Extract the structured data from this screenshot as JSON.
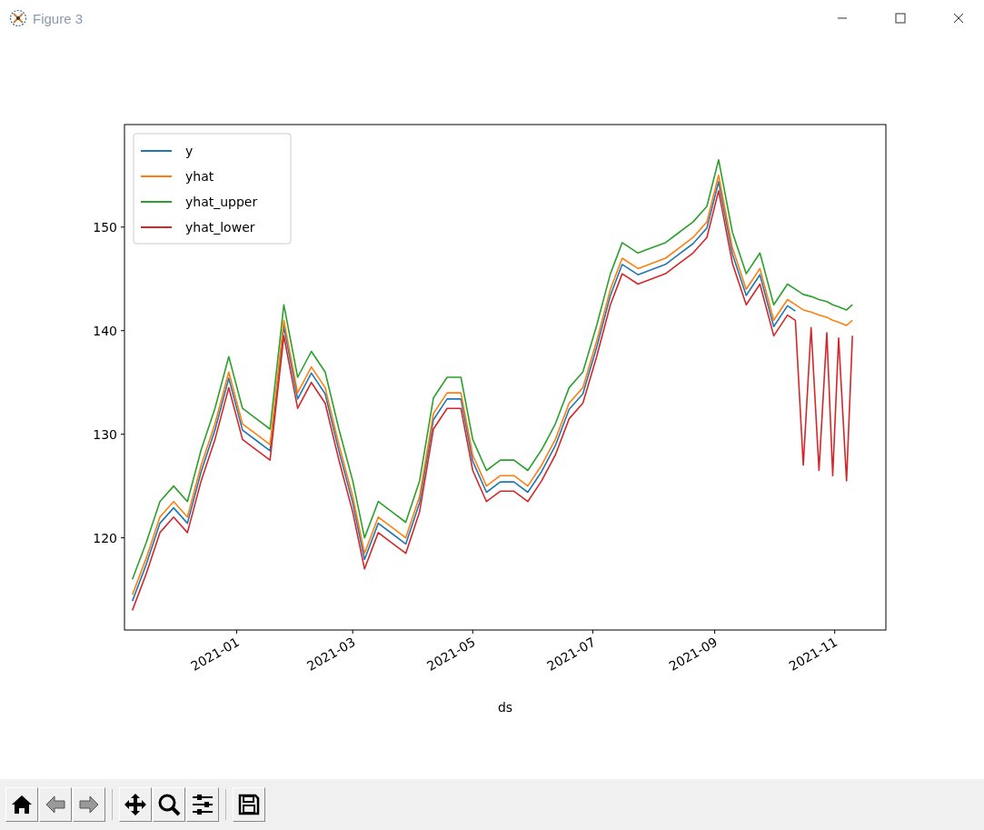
{
  "window": {
    "title": "Figure 3"
  },
  "figure": {
    "chart_data": {
      "type": "line",
      "xlabel": "ds",
      "x": [
        "2020-11-09",
        "2020-11-16",
        "2020-11-23",
        "2020-11-30",
        "2020-12-07",
        "2020-12-14",
        "2020-12-21",
        "2020-12-28",
        "2021-01-04",
        "2021-01-11",
        "2021-01-18",
        "2021-01-25",
        "2021-02-01",
        "2021-02-08",
        "2021-02-15",
        "2021-02-22",
        "2021-03-01",
        "2021-03-07",
        "2021-03-14",
        "2021-03-21",
        "2021-03-28",
        "2021-04-04",
        "2021-04-11",
        "2021-04-18",
        "2021-04-25",
        "2021-05-01",
        "2021-05-08",
        "2021-05-15",
        "2021-05-22",
        "2021-05-29",
        "2021-06-05",
        "2021-06-12",
        "2021-06-19",
        "2021-06-26",
        "2021-07-03",
        "2021-07-10",
        "2021-07-16",
        "2021-07-24",
        "2021-07-31",
        "2021-08-07",
        "2021-08-14",
        "2021-08-21",
        "2021-08-28",
        "2021-09-03",
        "2021-09-10",
        "2021-09-17",
        "2021-09-24",
        "2021-10-01",
        "2021-10-08",
        "2021-10-12",
        "2021-10-16",
        "2021-10-20",
        "2021-10-24",
        "2021-10-28",
        "2021-10-31",
        "2021-11-03",
        "2021-11-07",
        "2021-11-10"
      ],
      "series": [
        {
          "name": "y",
          "color": "#1f77b4",
          "values": [
            113.9,
            117.4,
            121.4,
            122.9,
            121.4,
            126.4,
            130.4,
            135.4,
            130.4,
            129.4,
            128.4,
            140.4,
            133.4,
            135.9,
            133.9,
            128.4,
            123.4,
            117.9,
            121.4,
            120.4,
            119.4,
            123.4,
            131.4,
            133.4,
            133.4,
            127.4,
            124.4,
            125.4,
            125.4,
            124.4,
            126.4,
            128.9,
            132.4,
            133.9,
            138.4,
            143.4,
            146.4,
            145.4,
            145.9,
            146.4,
            147.4,
            148.4,
            149.9,
            154.4,
            147.4,
            143.4,
            145.4,
            140.4,
            142.4,
            141.9,
            null,
            null,
            null,
            null,
            null,
            null,
            null,
            null
          ]
        },
        {
          "name": "yhat",
          "color": "#ff7f0e",
          "values": [
            114.5,
            118,
            122,
            123.5,
            122,
            127,
            131,
            136,
            131,
            130,
            129,
            141,
            134,
            136.5,
            134.5,
            129,
            124,
            118.5,
            122,
            121,
            120,
            124,
            132,
            134,
            134,
            128,
            125,
            126,
            126,
            125,
            127,
            129.5,
            133,
            134.5,
            139,
            144,
            147,
            146,
            146.5,
            147,
            148,
            149,
            150.5,
            155,
            148,
            144,
            146,
            141,
            143,
            142.5,
            142,
            141.8,
            141.5,
            141.3,
            141,
            140.8,
            140.5,
            141
          ]
        },
        {
          "name": "yhat_upper",
          "color": "#2ca02c",
          "values": [
            116,
            119.5,
            123.5,
            125,
            123.5,
            128.5,
            132.5,
            137.5,
            132.5,
            131.5,
            130.5,
            142.5,
            135.5,
            138,
            136,
            130.5,
            125.5,
            120,
            123.5,
            122.5,
            121.5,
            125.5,
            133.5,
            135.5,
            135.5,
            129.5,
            126.5,
            127.5,
            127.5,
            126.5,
            128.5,
            131,
            134.5,
            136,
            140.5,
            145.5,
            148.5,
            147.5,
            148,
            148.5,
            149.5,
            150.5,
            152,
            156.5,
            149.5,
            145.5,
            147.5,
            142.5,
            144.5,
            144,
            143.5,
            143.3,
            143,
            142.8,
            142.5,
            142.3,
            142,
            142.5
          ]
        },
        {
          "name": "yhat_lower",
          "color": "#d62728",
          "values": [
            113,
            116.5,
            120.5,
            122,
            120.5,
            125.5,
            129.5,
            134.5,
            129.5,
            128.5,
            127.5,
            139.5,
            132.5,
            135,
            133,
            127.5,
            122.5,
            117,
            120.5,
            119.5,
            118.5,
            122.5,
            130.5,
            132.5,
            132.5,
            126.5,
            123.5,
            124.5,
            124.5,
            123.5,
            125.5,
            128,
            131.5,
            133,
            137.5,
            142.5,
            145.5,
            144.5,
            145,
            145.5,
            146.5,
            147.5,
            149,
            153.5,
            146.5,
            142.5,
            144.5,
            139.5,
            141.5,
            141,
            127,
            140.3,
            126.5,
            139.8,
            126,
            139.3,
            125.5,
            139.5
          ]
        }
      ],
      "xlim": [
        "2020-11-05",
        "2021-11-27"
      ],
      "ylim": [
        111.1,
        159.9
      ],
      "xticks": [
        {
          "value": "2021-01-01",
          "label": "2021-01"
        },
        {
          "value": "2021-03-01",
          "label": "2021-03"
        },
        {
          "value": "2021-05-01",
          "label": "2021-05"
        },
        {
          "value": "2021-07-01",
          "label": "2021-07"
        },
        {
          "value": "2021-09-01",
          "label": "2021-09"
        },
        {
          "value": "2021-11-01",
          "label": "2021-11"
        }
      ],
      "yticks": [
        120,
        130,
        140,
        150
      ],
      "legend": "upper left"
    }
  }
}
